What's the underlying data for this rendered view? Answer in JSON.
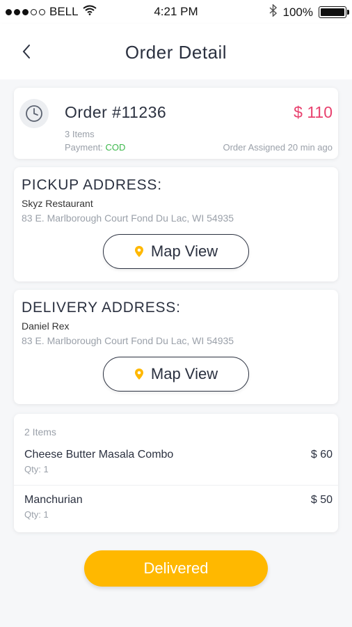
{
  "status_bar": {
    "carrier": "BELL",
    "time": "4:21 PM",
    "battery": "100%"
  },
  "nav": {
    "title": "Order Detail"
  },
  "order": {
    "number": "Order #11236",
    "amount": "$ 110",
    "items_count": "3 Items",
    "payment_label": "Payment:",
    "payment_method": "COD",
    "assigned": "Order Assigned 20 min ago"
  },
  "pickup": {
    "title": "PICKUP ADDRESS:",
    "name": "Skyz Restaurant",
    "address": "83 E. Marlborough Court Fond Du Lac, WI 54935",
    "map_button": "Map View"
  },
  "delivery": {
    "title": "DELIVERY ADDRESS:",
    "name": "Daniel Rex",
    "address": "83 E. Marlborough Court Fond Du Lac, WI 54935",
    "map_button": "Map View"
  },
  "items": {
    "header": "2 Items",
    "list": [
      {
        "name": "Cheese Butter Masala Combo",
        "qty": "Qty: 1",
        "price": "$ 60"
      },
      {
        "name": "Manchurian",
        "qty": "Qty: 1",
        "price": "$ 50"
      }
    ]
  },
  "action": {
    "delivered_label": "Delivered"
  },
  "colors": {
    "accent": "#ffb800",
    "price_red": "#e8416e",
    "cod_green": "#3bb84a",
    "text_dark": "#2b3140"
  },
  "icons": {
    "back": "chevron-left-icon",
    "clock": "clock-icon",
    "pin": "map-pin-icon"
  }
}
